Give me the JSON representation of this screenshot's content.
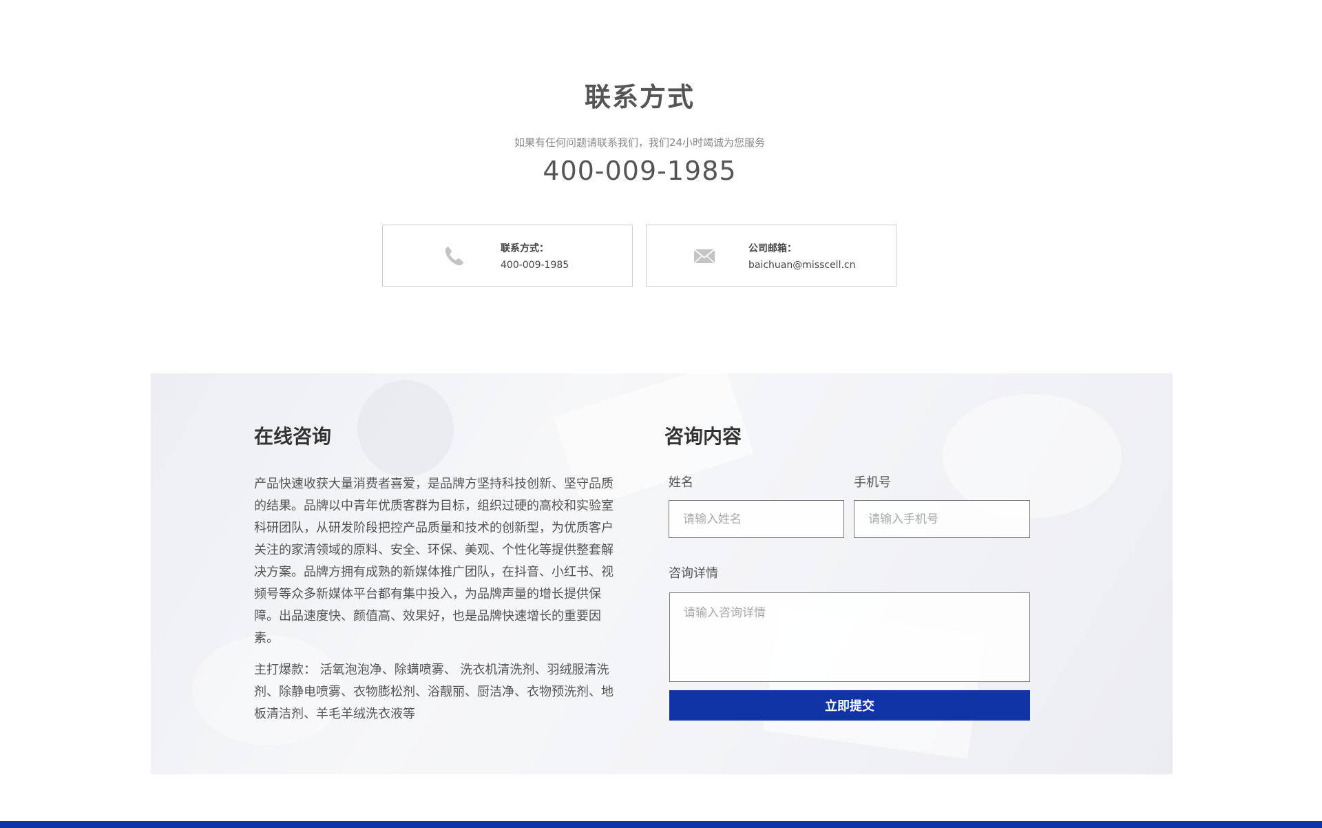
{
  "contact": {
    "title": "联系方式",
    "subtitle": "如果有任何问题请联系我们，我们24小时竭诚为您服务",
    "hotline": "400-009-1985"
  },
  "cards": {
    "phone": {
      "icon": "phone-icon",
      "label": "联系方式：",
      "value": "400-009-1985"
    },
    "mail": {
      "icon": "mail-icon",
      "label": "公司邮箱：",
      "value": "baichuan@misscell.cn"
    }
  },
  "consult": {
    "left_title": "在线咨询",
    "intro": "产品快速收获大量消费者喜爱，是品牌方坚持科技创新、坚守品质的结果。品牌以中青年优质客群为目标，组织过硬的高校和实验室科研团队，从研发阶段把控产品质量和技术的创新型，为优质客户关注的家清领域的原料、安全、环保、美观、个性化等提供整套解决方案。品牌方拥有成熟的新媒体推广团队，在抖音、小红书、视频号等众多新媒体平台都有集中投入，为品牌声量的增长提供保障。出品速度快、颜值高、效果好，也是品牌快速增长的重要因素。",
    "products": "主打爆款： 活氧泡泡净、除螨喷雾、 洗衣机清洗剂、羽绒服清洗剂、除静电喷雾、衣物膨松剂、浴靓丽、厨洁净、衣物预洗剂、地板清洁剂、羊毛羊绒洗衣液等",
    "right_title": "咨询内容",
    "form": {
      "name_label": "姓名",
      "name_placeholder": "请输入姓名",
      "phone_label": "手机号",
      "phone_placeholder": "请输入手机号",
      "detail_label": "咨询详情",
      "detail_placeholder": "请输入咨询详情",
      "submit_label": "立即提交"
    }
  },
  "colors": {
    "accent": "#1034a6",
    "text": "#555555",
    "icon": "#c4c4c4"
  }
}
